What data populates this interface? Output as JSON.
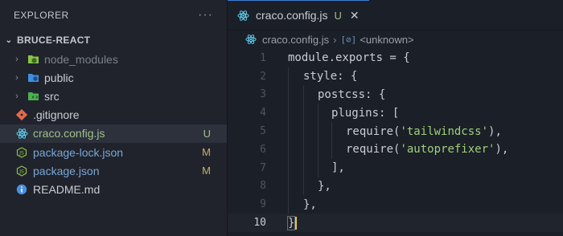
{
  "explorer": {
    "title": "EXPLORER",
    "more": "···",
    "project": "BRUCE-REACT",
    "items": [
      {
        "name": "node_modules",
        "twisty": "›",
        "badge": "",
        "icon": "folder-node-icon"
      },
      {
        "name": "public",
        "twisty": "›",
        "badge": "",
        "icon": "folder-public-icon"
      },
      {
        "name": "src",
        "twisty": "›",
        "badge": "",
        "icon": "folder-src-icon"
      },
      {
        "name": ".gitignore",
        "twisty": "",
        "badge": "",
        "icon": "git-icon"
      },
      {
        "name": "craco.config.js",
        "twisty": "",
        "badge": "U",
        "icon": "react-icon"
      },
      {
        "name": "package-lock.json",
        "twisty": "",
        "badge": "M",
        "icon": "js-icon"
      },
      {
        "name": "package.json",
        "twisty": "",
        "badge": "M",
        "icon": "js-icon"
      },
      {
        "name": "README.md",
        "twisty": "",
        "badge": "",
        "icon": "info-icon"
      }
    ]
  },
  "tab": {
    "label": "craco.config.js",
    "status": "U",
    "close": "✕"
  },
  "breadcrumb": {
    "file": "craco.config.js",
    "separator": "›",
    "symbol_icon": "[⊘]",
    "symbol": "<unknown>"
  },
  "editor": {
    "line_numbers": [
      "1",
      "2",
      "3",
      "4",
      "5",
      "6",
      "7",
      "8",
      "9",
      "10"
    ],
    "active_line": "10",
    "code": {
      "l1a": "module.exports = ",
      "l1b": "{",
      "l2a": "style",
      "l2b": ": {",
      "l3a": "postcss",
      "l3b": ": {",
      "l4a": "plugins",
      "l4b": ": [",
      "l5a": "require(",
      "l5b": "'tailwindcss'",
      "l5c": "),",
      "l6a": "require(",
      "l6b": "'autoprefixer'",
      "l6c": "),",
      "l7": "],",
      "l8": "},",
      "l9": "},",
      "l10": "}"
    }
  },
  "colors": {
    "accent": "#3c7fd6",
    "untracked": "#a3c08b",
    "modified": "#c6b06a",
    "string": "#9fd17a",
    "cursor": "#e8c546"
  }
}
